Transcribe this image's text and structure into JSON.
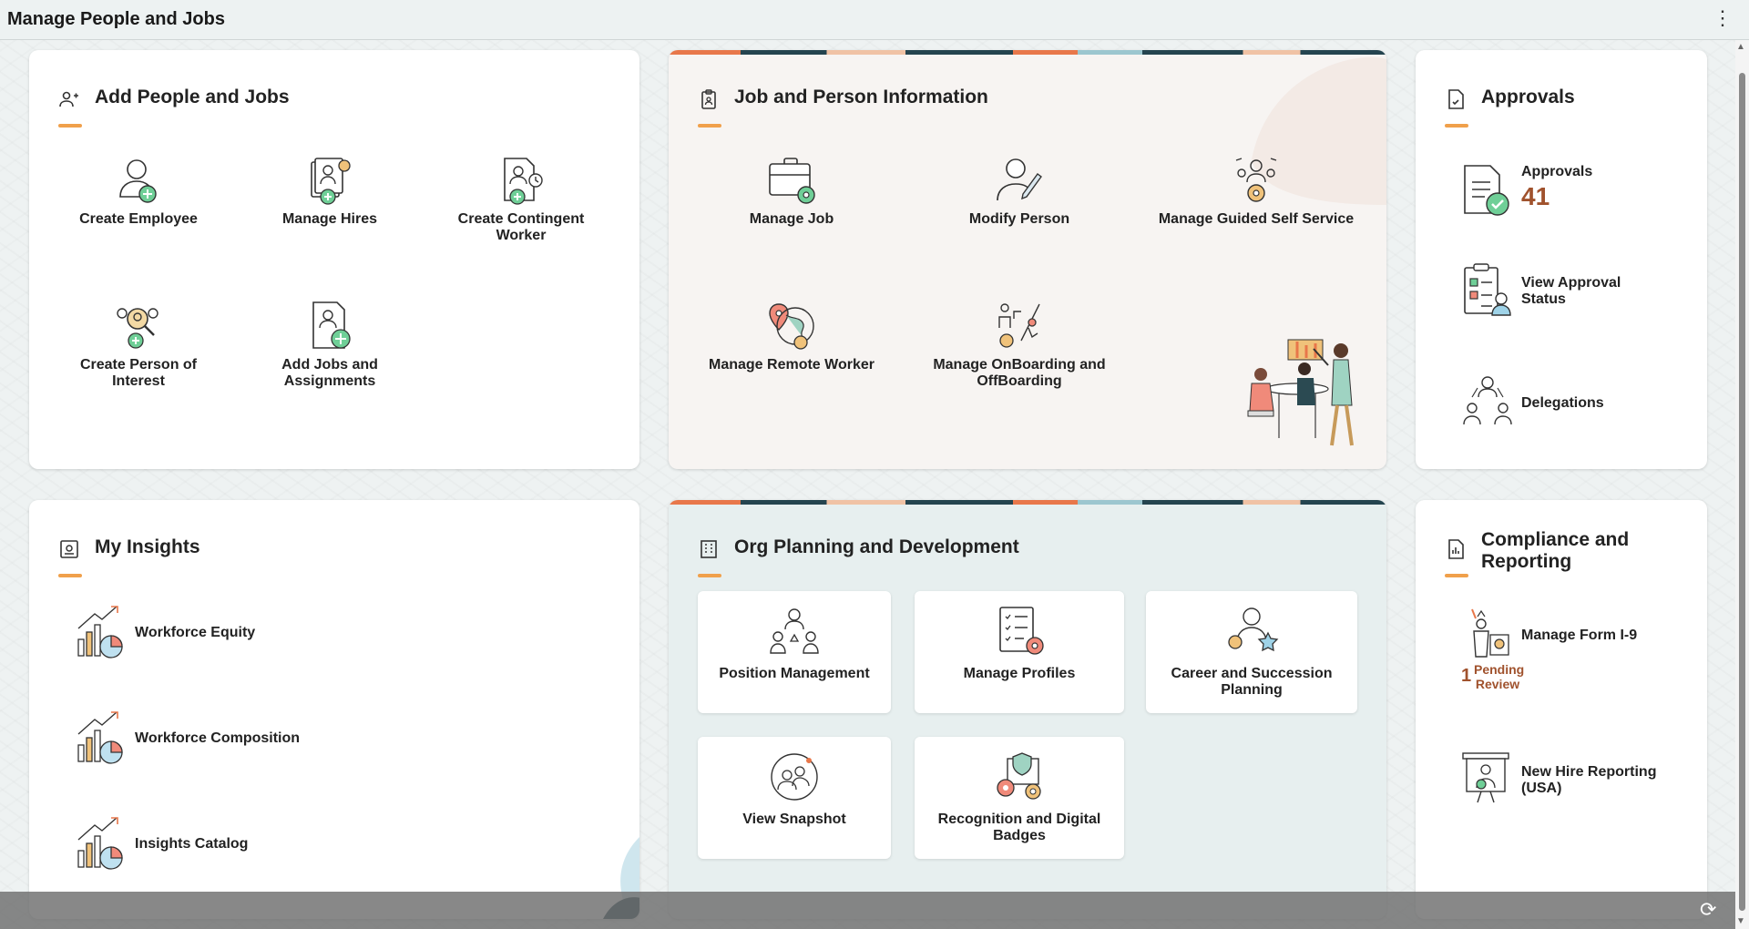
{
  "page": {
    "title": "Manage People and Jobs"
  },
  "add_people": {
    "title": "Add People and Jobs",
    "tiles": [
      {
        "label": "Create Employee"
      },
      {
        "label": "Manage Hires"
      },
      {
        "label": "Create Contingent Worker"
      },
      {
        "label": "Create Person of Interest"
      },
      {
        "label": "Add Jobs and Assignments"
      }
    ]
  },
  "job_person": {
    "title": "Job and Person Information",
    "tiles": [
      {
        "label": "Manage Job"
      },
      {
        "label": "Modify Person"
      },
      {
        "label": "Manage Guided Self Service"
      },
      {
        "label": "Manage Remote Worker"
      },
      {
        "label": "Manage OnBoarding and OffBoarding"
      }
    ]
  },
  "approvals": {
    "title": "Approvals",
    "items": [
      {
        "label": "Approvals",
        "count": "41"
      },
      {
        "label": "View Approval Status"
      },
      {
        "label": "Delegations"
      }
    ]
  },
  "insights": {
    "title": "My Insights",
    "items": [
      {
        "label": "Workforce Equity"
      },
      {
        "label": "Workforce Composition"
      },
      {
        "label": "Insights Catalog"
      }
    ]
  },
  "org_planning": {
    "title": "Org Planning and Development",
    "cards": [
      {
        "label": "Position Management"
      },
      {
        "label": "Manage Profiles"
      },
      {
        "label": "Career and Succession Planning"
      },
      {
        "label": "View Snapshot"
      },
      {
        "label": "Recognition and Digital Badges"
      }
    ]
  },
  "compliance": {
    "title": "Compliance and Reporting",
    "items": [
      {
        "label": "Manage Form I-9",
        "pending_count": "1",
        "pending_text": "Pending Review"
      },
      {
        "label": "New Hire Reporting (USA)"
      }
    ]
  },
  "colors": {
    "accent": "#f0a04b",
    "count": "#a0522d",
    "badge_green": "#6fcf97"
  }
}
